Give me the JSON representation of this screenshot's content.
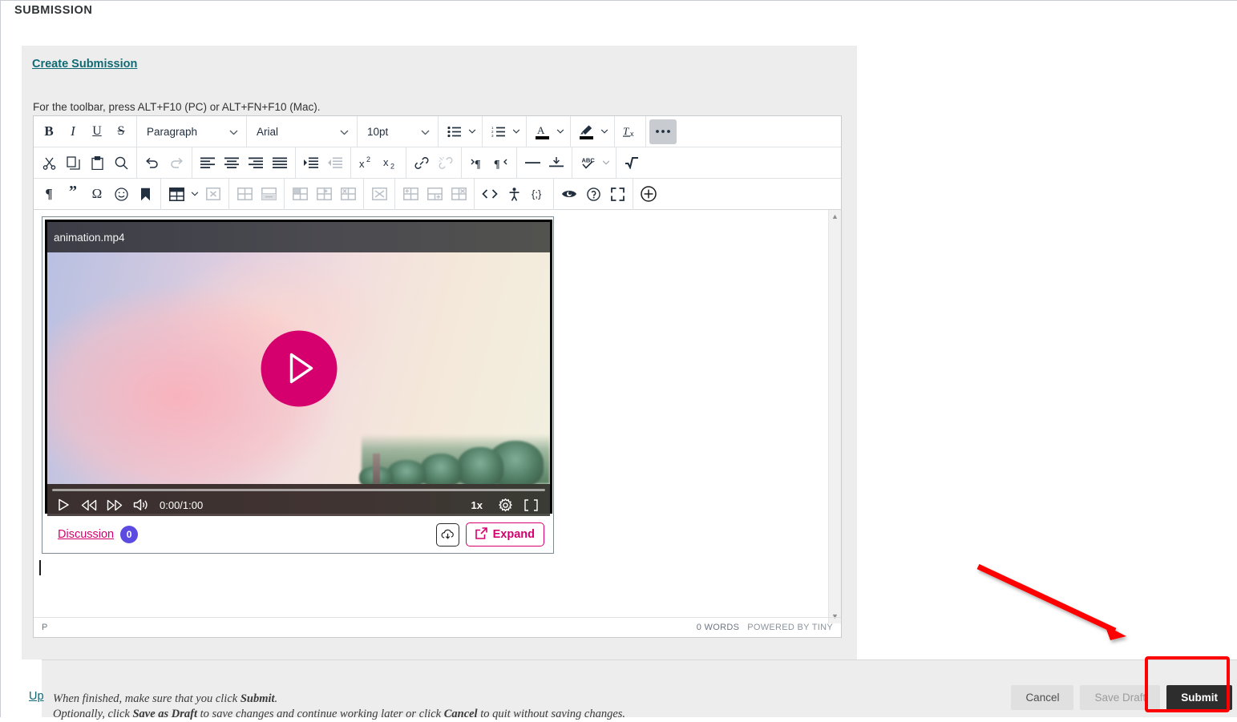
{
  "page": {
    "section_heading": "SUBMISSION"
  },
  "submission": {
    "create_link": "Create Submission",
    "toolbar_hint": "For the toolbar, press ALT+F10 (PC) or ALT+FN+F10 (Mac)."
  },
  "editor": {
    "selects": [
      {
        "name": "block-format",
        "value": "Paragraph"
      },
      {
        "name": "font-family",
        "value": "Arial"
      },
      {
        "name": "font-size",
        "value": "10pt"
      }
    ],
    "row1": [
      {
        "icon": "bold-icon",
        "label": "Bold"
      },
      {
        "icon": "italic-icon",
        "label": "Italic"
      },
      {
        "icon": "underline-icon",
        "label": "Underline"
      },
      {
        "icon": "strikethrough-icon",
        "label": "Strikethrough"
      },
      {
        "icon": "bullet-list-icon",
        "label": "Bullet list"
      },
      {
        "icon": "numbered-list-icon",
        "label": "Numbered list"
      },
      {
        "icon": "text-color-icon",
        "label": "Text color"
      },
      {
        "icon": "highlight-color-icon",
        "label": "Background color"
      },
      {
        "icon": "clear-formatting-icon",
        "label": "Clear formatting"
      },
      {
        "icon": "more-options-icon",
        "label": "Reveal or hide additional toolbar items"
      }
    ],
    "row2": [
      {
        "icon": "cut-icon",
        "label": "Cut"
      },
      {
        "icon": "copy-icon",
        "label": "Copy"
      },
      {
        "icon": "paste-icon",
        "label": "Paste"
      },
      {
        "icon": "search-icon",
        "label": "Find and replace"
      },
      {
        "icon": "undo-icon",
        "label": "Undo"
      },
      {
        "icon": "redo-icon",
        "label": "Redo"
      },
      {
        "icon": "align-left-icon",
        "label": "Align left"
      },
      {
        "icon": "align-center-icon",
        "label": "Align center"
      },
      {
        "icon": "align-right-icon",
        "label": "Align right"
      },
      {
        "icon": "align-justify-icon",
        "label": "Justify"
      },
      {
        "icon": "indent-icon",
        "label": "Increase indent"
      },
      {
        "icon": "outdent-icon",
        "label": "Decrease indent"
      },
      {
        "icon": "superscript-icon",
        "label": "Superscript"
      },
      {
        "icon": "subscript-icon",
        "label": "Subscript"
      },
      {
        "icon": "insert-link-icon",
        "label": "Insert/edit link"
      },
      {
        "icon": "remove-link-icon",
        "label": "Remove link"
      },
      {
        "icon": "ltr-icon",
        "label": "Left to right"
      },
      {
        "icon": "rtl-icon",
        "label": "Right to left"
      },
      {
        "icon": "horizontal-rule-icon",
        "label": "Horizontal line"
      },
      {
        "icon": "page-break-icon",
        "label": "Page break"
      },
      {
        "icon": "spellcheck-icon",
        "label": "Spellcheck"
      },
      {
        "icon": "math-icon",
        "label": "Equation"
      }
    ],
    "row3": [
      {
        "icon": "paragraph-mark-icon",
        "label": "Show invisible characters"
      },
      {
        "icon": "blockquote-icon",
        "label": "Blockquote"
      },
      {
        "icon": "special-character-icon",
        "label": "Special character"
      },
      {
        "icon": "emoticon-icon",
        "label": "Emoticons"
      },
      {
        "icon": "anchor-icon",
        "label": "Anchor"
      },
      {
        "icon": "insert-table-icon",
        "label": "Table"
      },
      {
        "icon": "delete-table-icon",
        "label": "Delete table"
      },
      {
        "icon": "insert-row-before-icon",
        "label": "Insert row before"
      },
      {
        "icon": "insert-row-after-icon",
        "label": "Insert row after"
      },
      {
        "icon": "delete-row-icon",
        "label": "Delete row"
      },
      {
        "icon": "insert-column-before-icon",
        "label": "Insert column before"
      },
      {
        "icon": "insert-column-after-icon",
        "label": "Insert column after"
      },
      {
        "icon": "delete-column-icon",
        "label": "Delete column"
      },
      {
        "icon": "merge-cells-icon",
        "label": "Merge cells"
      },
      {
        "icon": "split-cell-icon",
        "label": "Split cell"
      },
      {
        "icon": "table-cell-props-icon",
        "label": "Cell properties"
      },
      {
        "icon": "source-code-icon",
        "label": "Source code"
      },
      {
        "icon": "accessibility-icon",
        "label": "Accessibility checker"
      },
      {
        "icon": "template-icon",
        "label": "Insert template"
      },
      {
        "icon": "preview-icon",
        "label": "Preview"
      },
      {
        "icon": "help-icon",
        "label": "Help"
      },
      {
        "icon": "fullscreen-icon",
        "label": "Fullscreen"
      },
      {
        "icon": "insert-plus-icon",
        "label": "Insert"
      }
    ],
    "statusbar": {
      "element_path": "P",
      "word_count": "0 WORDS",
      "powered_by": "POWERED BY TINY"
    }
  },
  "video": {
    "filename": "animation.mp4",
    "time": "0:00/1:00",
    "speed": "1x",
    "play_icon": "play-icon",
    "controls": [
      {
        "icon": "play-icon",
        "label": "Play"
      },
      {
        "icon": "rewind-icon",
        "label": "Rewind"
      },
      {
        "icon": "fast-forward-icon",
        "label": "Fast forward"
      },
      {
        "icon": "volume-icon",
        "label": "Volume"
      }
    ],
    "right_controls": [
      {
        "icon": "settings-gear-icon",
        "label": "Settings"
      },
      {
        "icon": "fullscreen-icon",
        "label": "Fullscreen"
      }
    ],
    "progress_percent": 0,
    "discussion": {
      "link": "Discussion",
      "count": "0",
      "download_icon": "download-cloud-icon",
      "expand_label": "Expand",
      "expand_icon": "external-link-icon"
    },
    "accent_color": "#d5006d",
    "badge_color": "#5b4be0"
  },
  "bottom": {
    "upload_link": "Up",
    "note_line1_pre": "When finished, make sure that you click ",
    "note_line1_bold": "Submit",
    "note_line1_post": ".",
    "note_line2_pre": "Optionally, click ",
    "note_line2_bold1": "Save as Draft",
    "note_line2_mid": " to save changes and continue working later or click ",
    "note_line2_bold2": "Cancel",
    "note_line2_post": " to quit without saving changes.",
    "buttons": {
      "cancel": "Cancel",
      "save_draft": "Save Draft",
      "submit": "Submit"
    }
  },
  "annotations": {
    "arrow_color": "#ff0000",
    "box_color": "#ff0000"
  }
}
